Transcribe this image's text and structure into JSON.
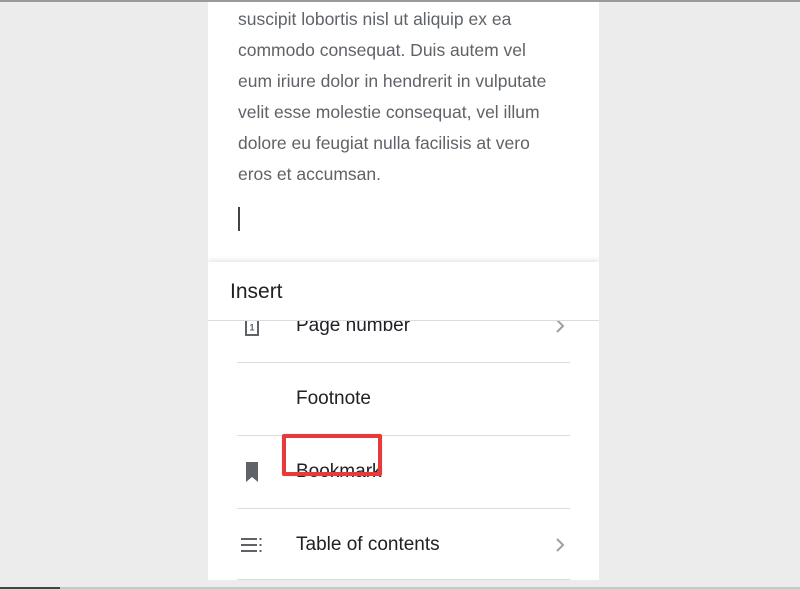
{
  "document": {
    "lines": [
      "suscipit lobortis nisl ut aliquip ex ea",
      "commodo consequat. Duis autem vel",
      "eum iriure dolor in hendrerit in vulputate",
      "velit esse molestie consequat, vel illum",
      "dolore eu feugiat nulla facilisis at vero",
      "eros et accumsan."
    ]
  },
  "insert_sheet": {
    "title": "Insert",
    "items": [
      {
        "label": "Page number",
        "icon": "page-number-icon",
        "has_submenu": true
      },
      {
        "label": "Footnote",
        "icon": "",
        "has_submenu": false,
        "highlighted": true
      },
      {
        "label": "Bookmark",
        "icon": "bookmark-icon",
        "has_submenu": false
      },
      {
        "label": "Table of contents",
        "icon": "table-of-contents-icon",
        "has_submenu": true
      }
    ],
    "page_number_icon_glyph": "1"
  },
  "colors": {
    "highlight": "#e83a3a",
    "text": "#5f6368",
    "icon": "#5f6368"
  }
}
